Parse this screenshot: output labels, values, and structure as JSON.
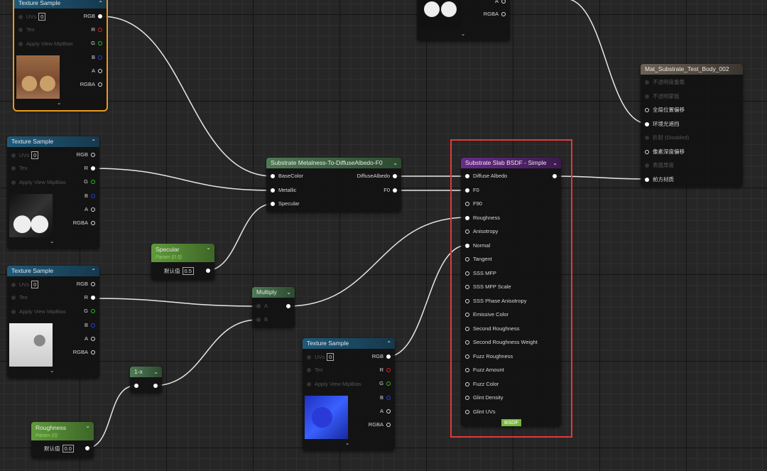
{
  "colors": {
    "selection": "#e89a1c",
    "highlight_box": "#e23a3a",
    "texture_header": "#1f5a7a",
    "function_header": "#4f7a55",
    "substrate_header": "#6a2a8a",
    "param_header": "#5f9a3a",
    "wire": "#e6e6e6"
  },
  "texture_sample": {
    "title": "Texture Sample",
    "inputs": [
      "UVs",
      "Tex",
      "Apply View MipBias"
    ],
    "uv_value": "0",
    "outputs": [
      "RGB",
      "R",
      "G",
      "B",
      "A",
      "RGBA"
    ]
  },
  "top_node": {
    "outputs": [
      "A",
      "RGBA"
    ]
  },
  "metalness_node": {
    "title": "Substrate Metalness-To-DiffuseAlbedo-F0",
    "inputs": [
      "BaseColor",
      "Metallic",
      "Specular"
    ],
    "outputs": [
      "DiffuseAlbedo",
      "F0"
    ]
  },
  "specular_param": {
    "title": "Specular",
    "subtitle": "Param (0.5)",
    "label": "默认值",
    "value": "0.5"
  },
  "roughness_param": {
    "title": "Roughness",
    "subtitle": "Param (0)",
    "label": "默认值",
    "value": "0.0"
  },
  "multiply_node": {
    "title": "Multiply",
    "inputs": [
      "A",
      "B"
    ]
  },
  "one_minus_node": {
    "title": "1-x"
  },
  "bsdf_node": {
    "title": "Substrate Slab BSDF - Simple",
    "inputs": [
      "Diffuse Albedo",
      "F0",
      "F90",
      "Roughness",
      "Anisotropy",
      "Normal",
      "Tangent",
      "SSS MFP",
      "SSS MFP Scale",
      "SSS Phase Anisotropy",
      "Emissive Color",
      "Second Roughness",
      "Second Roughness Weight",
      "Fuzz Roughness",
      "Fuzz Amount",
      "Fuzz Color",
      "Glint Density",
      "Glint UVs"
    ],
    "connected": [
      true,
      true,
      false,
      true,
      false,
      true,
      false,
      false,
      false,
      false,
      false,
      false,
      false,
      false,
      false,
      false,
      false,
      false
    ],
    "tag": "BSDF"
  },
  "result_node": {
    "title": "Mat_Substrate_Test_Body_002",
    "inputs": [
      "不透明度重载",
      "不透明蒙版",
      "全局位置偏移",
      "环境光遮挡",
      "折射 (Disabled)",
      "像素深度偏移",
      "表面厚度",
      "前方材质"
    ],
    "state": [
      "dim",
      "dim",
      "off",
      "on",
      "dim",
      "off",
      "dim",
      "on"
    ]
  }
}
